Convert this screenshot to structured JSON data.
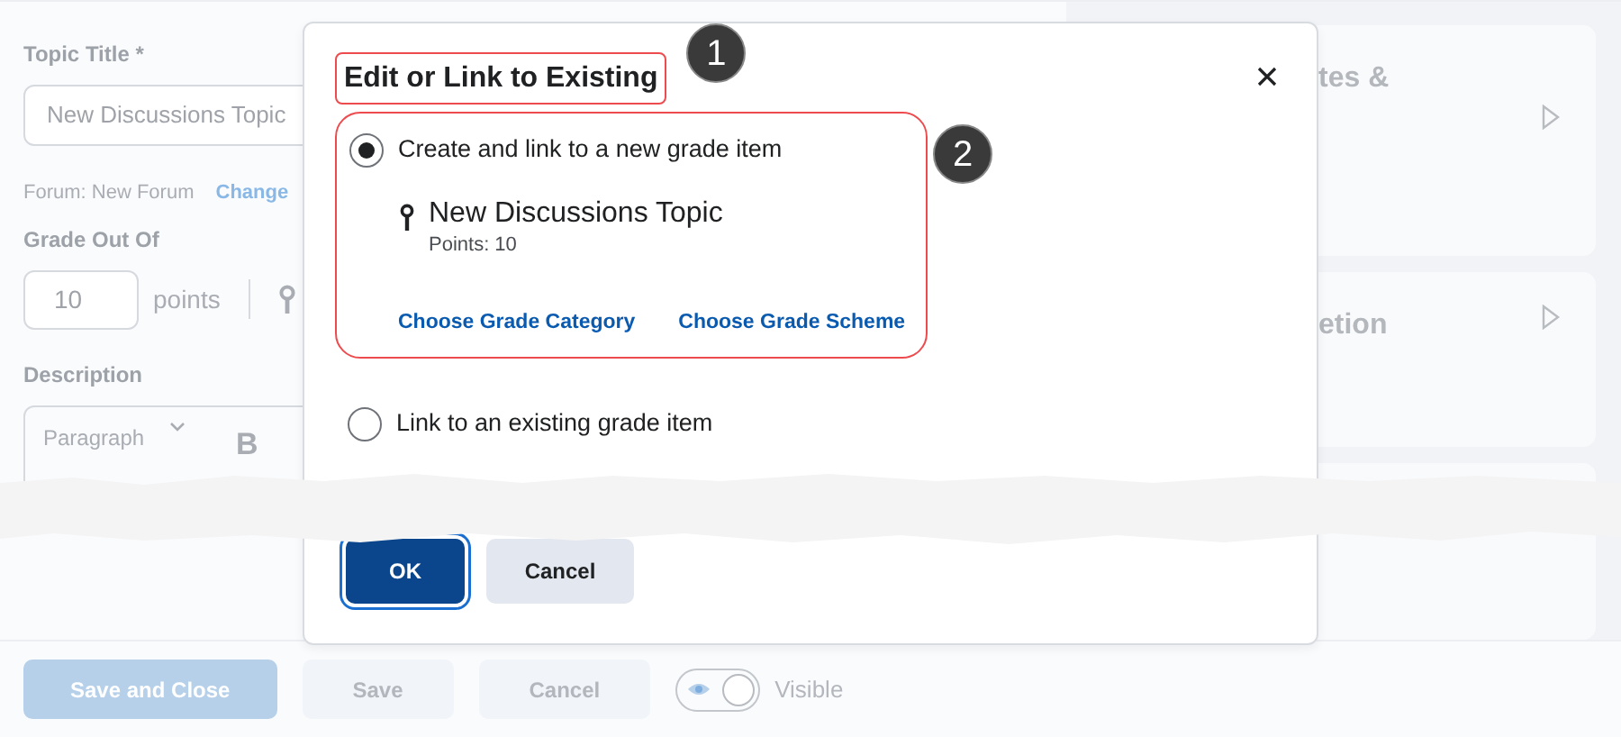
{
  "form": {
    "title_label": "Topic Title *",
    "title_value": "New Discussions Topic",
    "forum": "Forum: New Forum",
    "change_link": "Change",
    "grade_label": "Grade Out Of",
    "grade_value": "10",
    "grade_unit": "points",
    "description_label": "Description",
    "format_select": "Paragraph",
    "bold_button": "B"
  },
  "side_panels": [
    {
      "title": "tes &"
    },
    {
      "title": "etion"
    }
  ],
  "footer": {
    "buttons": [
      {
        "label": "Save and Close",
        "kind": "primary"
      },
      {
        "label": "Save",
        "kind": "secondary"
      },
      {
        "label": "Cancel",
        "kind": "secondary"
      }
    ],
    "visibility": {
      "label": "Visible",
      "on": true
    }
  },
  "dialog": {
    "title": "Edit or Link to Existing",
    "options": [
      {
        "label": "Create and link to a new grade item",
        "selected": true,
        "item": {
          "name": "New Discussions Topic",
          "points": "Points: 10"
        },
        "links": [
          "Choose Grade Category",
          "Choose Grade Scheme"
        ]
      },
      {
        "label": "Link to an existing grade item",
        "selected": false
      }
    ],
    "buttons": [
      {
        "label": "OK",
        "kind": "primary"
      },
      {
        "label": "Cancel",
        "kind": "secondary"
      }
    ]
  },
  "annotations": [
    {
      "number": "1"
    },
    {
      "number": "2"
    }
  ]
}
